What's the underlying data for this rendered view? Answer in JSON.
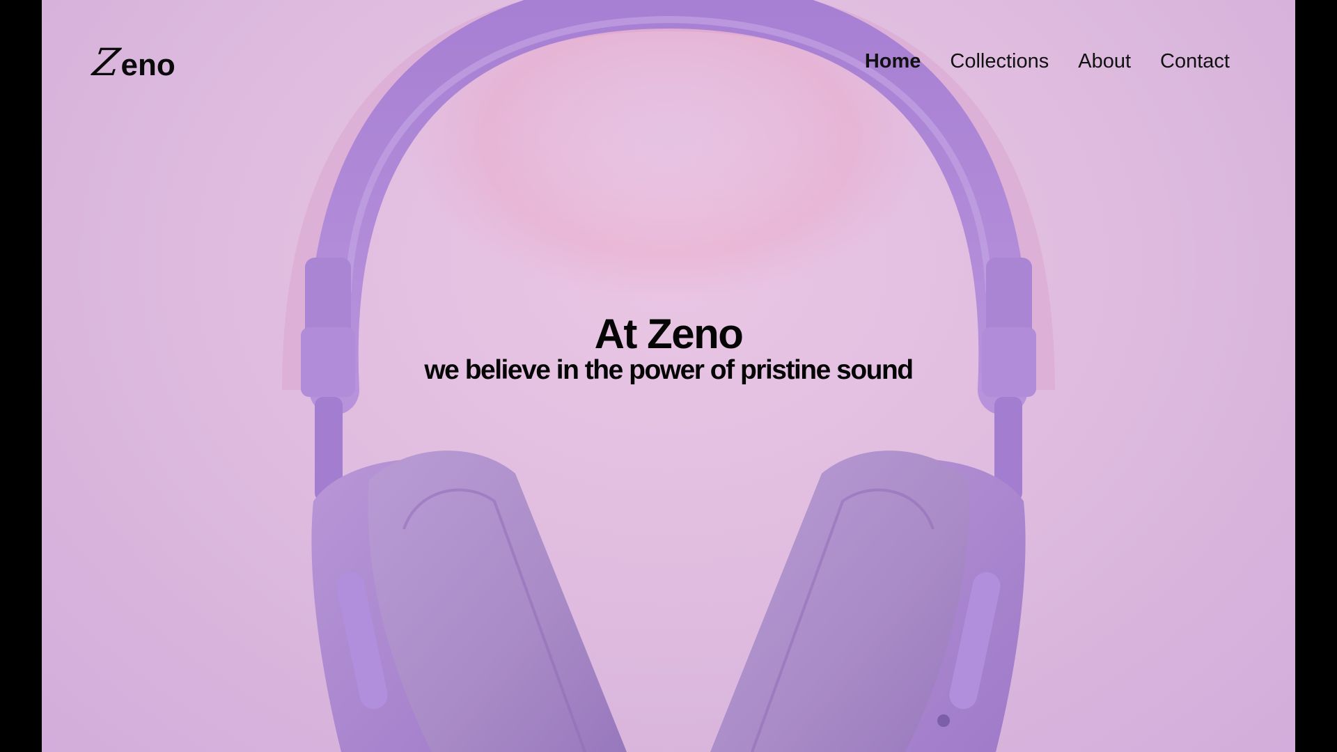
{
  "nav": {
    "logo_letter": "Z",
    "logo_rest": "eno",
    "links": [
      {
        "label": "Home",
        "active": true
      },
      {
        "label": "Collections",
        "active": false
      },
      {
        "label": "About",
        "active": false
      },
      {
        "label": "Contact",
        "active": false
      }
    ]
  },
  "hero": {
    "headline": "At Zeno",
    "tagline": "we believe in the power of pristine sound",
    "image_subject": "purple-headphones"
  },
  "colors": {
    "background": "#e0bde0",
    "headphone": "#b58bd6",
    "text": "#050505"
  }
}
